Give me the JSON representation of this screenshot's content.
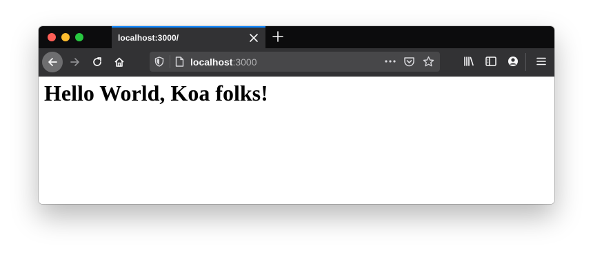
{
  "browser": {
    "window_controls": [
      "close",
      "minimize",
      "maximize"
    ],
    "tab": {
      "title": "localhost:3000/",
      "close_icon": "close-icon"
    },
    "new_tab_icon": "plus-icon",
    "toolbar": {
      "back_icon": "arrow-left-icon",
      "forward_icon": "arrow-right-icon",
      "reload_icon": "reload-icon",
      "home_icon": "home-icon",
      "address": {
        "host": "localhost",
        "port": ":3000"
      },
      "page_actions": [
        "meatball-menu-icon",
        "pocket-icon",
        "bookmark-star-icon"
      ],
      "right_icons": [
        "library-icon",
        "sidebar-icon",
        "account-icon",
        "hamburger-menu-icon"
      ]
    },
    "colors": {
      "tabstrip": "#0c0c0d",
      "toolbar": "#323234",
      "urlbar": "#474749",
      "tab_accent": "#0a84ff"
    }
  },
  "page": {
    "heading": "Hello World, Koa folks!"
  }
}
